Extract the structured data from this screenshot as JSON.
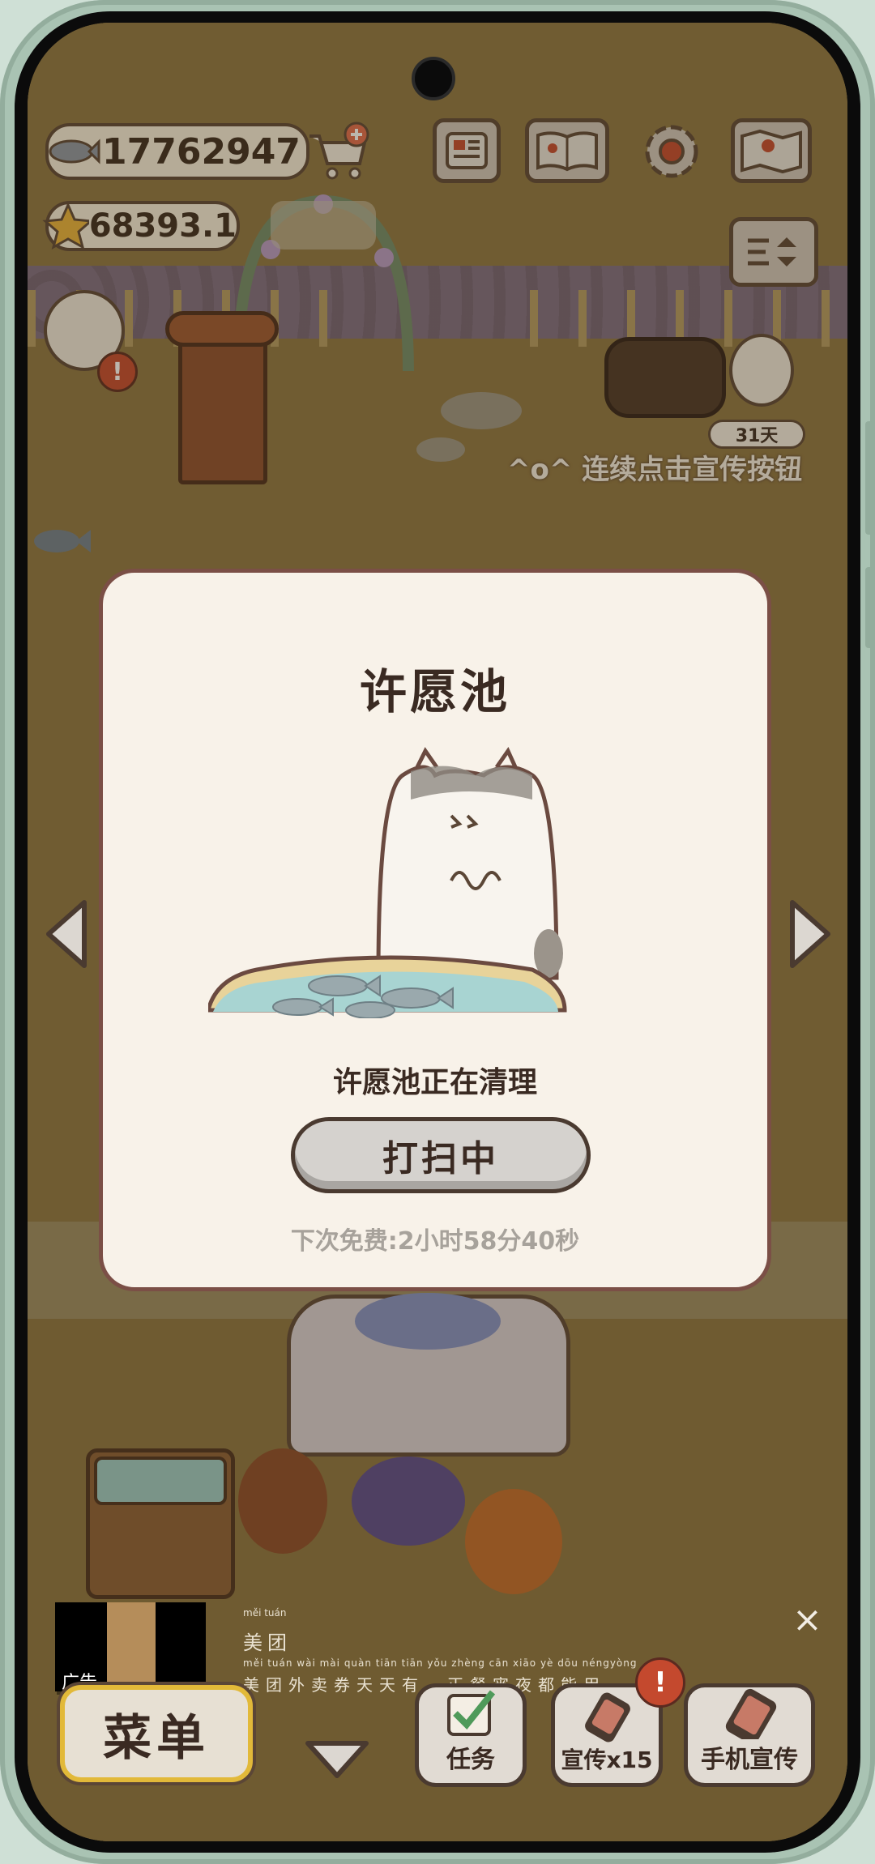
{
  "hud": {
    "fish_count": "17762947",
    "star_count": "68393.1"
  },
  "scene": {
    "streak_days": "31天",
    "promo_hint": "^o^ 连续点击宣传按钮"
  },
  "dialog": {
    "title": "许愿池",
    "message": "许愿池正在清理",
    "button_label": "打扫中",
    "timer_text": "下次免费:2小时58分40秒"
  },
  "bottom_bar": {
    "menu_label": "菜单",
    "task_label": "任务",
    "promo_label": "宣传x15",
    "phone_promo_label": "手机宣传",
    "alert_mark": "!"
  },
  "ad": {
    "label": "广告",
    "title": "美团",
    "title_pinyin": "měi tuán",
    "description": "美团外卖券天天有，正餐宵夜都能用。",
    "description_pinyin": "měi tuán wài mài quàn tiān tiān yǒu   zhèng cān xiāo yè dōu néngyòng",
    "close_symbol": "×"
  },
  "icons": [
    "fish-icon",
    "cart-add-icon",
    "star-icon",
    "newspaper-icon",
    "book-icon",
    "gear-icon",
    "map-icon",
    "sort-icon",
    "left-arrow-icon",
    "right-arrow-icon",
    "down-arrow-icon",
    "checkbox-icon",
    "phone-icon"
  ],
  "colors": {
    "dialog_bg": "#f8f2e9",
    "dialog_border": "#7b4f46",
    "menu_border": "#e2b939",
    "alert": "#c4492e",
    "water": "#a8d4d2"
  }
}
